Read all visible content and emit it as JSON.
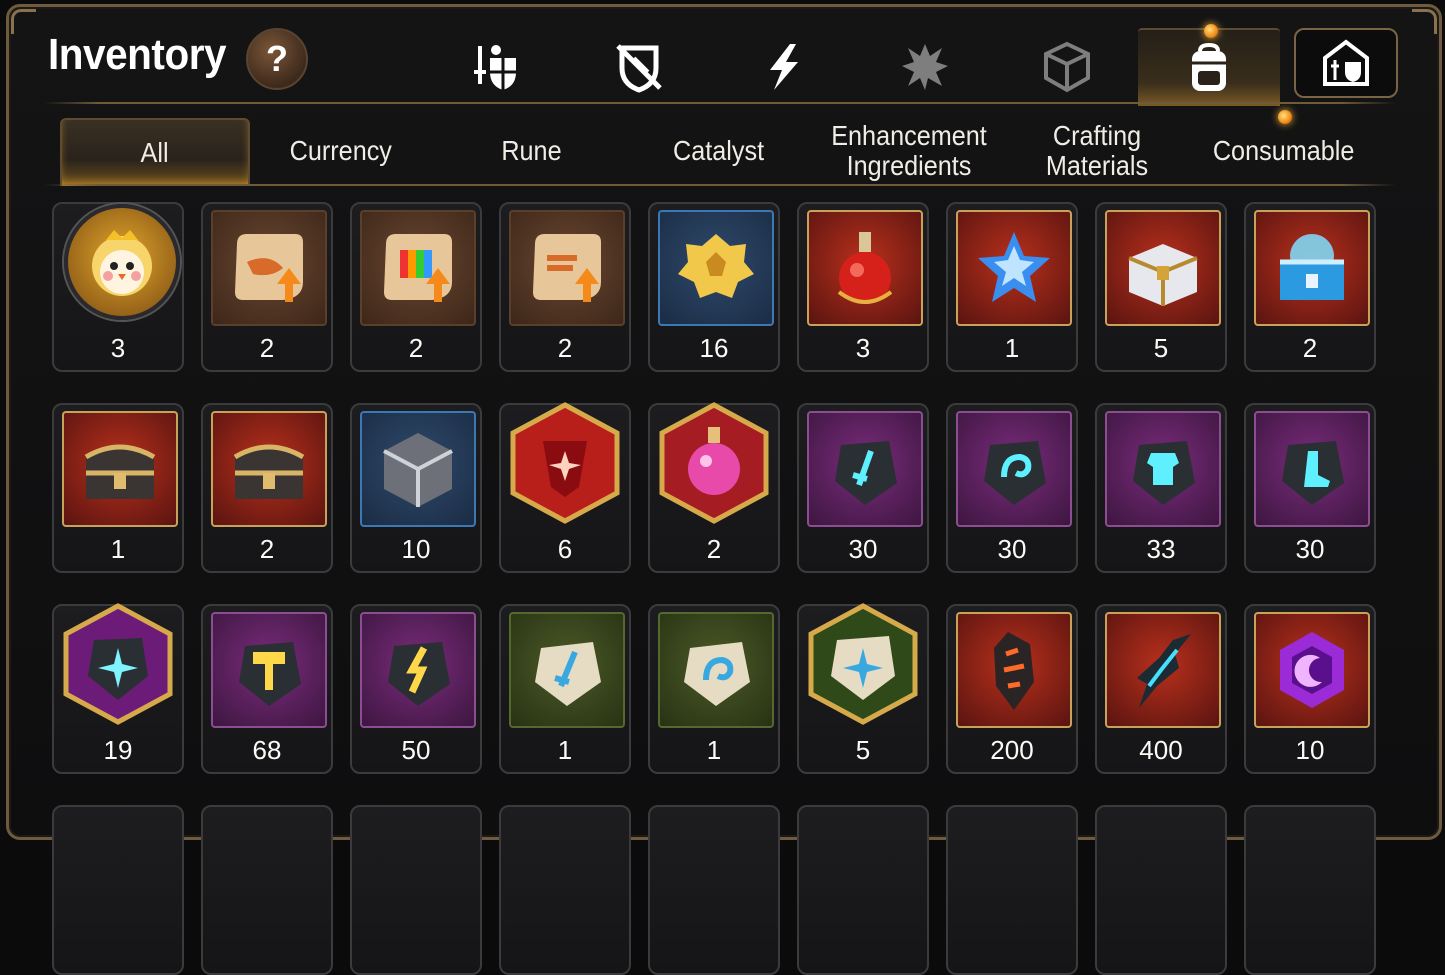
{
  "header": {
    "title": "Inventory",
    "help_label": "?"
  },
  "top_icons": [
    {
      "name": "equipment-sword-shield",
      "active": false
    },
    {
      "name": "shield-crossed",
      "active": false
    },
    {
      "name": "lightning",
      "active": false
    },
    {
      "name": "splash-emblem",
      "active": false
    },
    {
      "name": "dice-cube",
      "active": false
    },
    {
      "name": "backpack",
      "active": true,
      "notification": true
    },
    {
      "name": "sword-shield-house",
      "active": false
    }
  ],
  "tabs": [
    {
      "label": "All",
      "active": true
    },
    {
      "label": "Currency",
      "active": false
    },
    {
      "label": "Rune",
      "active": false
    },
    {
      "label": "Catalyst",
      "active": false
    },
    {
      "label": "Enhancement Ingredients",
      "active": false
    },
    {
      "label": "Crafting Materials",
      "active": false
    },
    {
      "label": "Consumable",
      "active": false,
      "notification": true
    }
  ],
  "items": [
    {
      "icon": "chick-medal-icon",
      "count": "3"
    },
    {
      "icon": "scroll-upgrade-icon",
      "count": "2"
    },
    {
      "icon": "rainbow-scroll-upgrade-icon",
      "count": "2"
    },
    {
      "icon": "scroll-upgrade-icon",
      "count": "2"
    },
    {
      "icon": "gold-nugget-icon",
      "count": "16"
    },
    {
      "icon": "red-potion-icon",
      "count": "3"
    },
    {
      "icon": "blue-star-potion-icon",
      "count": "1"
    },
    {
      "icon": "silver-gold-chest-icon",
      "count": "5"
    },
    {
      "icon": "blue-crystal-chest-icon",
      "count": "2"
    },
    {
      "icon": "dark-gold-chest-icon",
      "count": "1"
    },
    {
      "icon": "dark-gold-chest-icon",
      "count": "2"
    },
    {
      "icon": "silver-cube-icon",
      "count": "10"
    },
    {
      "icon": "red-gem-hex-icon",
      "count": "6"
    },
    {
      "icon": "pink-potion-hex-icon",
      "count": "2"
    },
    {
      "icon": "sword-stone-icon",
      "count": "30"
    },
    {
      "icon": "swirl-stone-icon",
      "count": "30"
    },
    {
      "icon": "armor-stone-icon",
      "count": "33"
    },
    {
      "icon": "boot-stone-icon",
      "count": "30"
    },
    {
      "icon": "star-stone-hex-icon",
      "count": "19"
    },
    {
      "icon": "hammer-stone-icon",
      "count": "68"
    },
    {
      "icon": "bolt-stone-icon",
      "count": "50"
    },
    {
      "icon": "sword-rune-icon",
      "count": "1"
    },
    {
      "icon": "swirl-rune-icon",
      "count": "1"
    },
    {
      "icon": "star-rune-hex-icon",
      "count": "5"
    },
    {
      "icon": "lava-crystal-icon",
      "count": "200"
    },
    {
      "icon": "dark-crystal-shard-icon",
      "count": "400"
    },
    {
      "icon": "moon-gem-icon",
      "count": "10"
    }
  ],
  "colors": {
    "gold_frame": "#6e5a3e",
    "accent_glow": "#d99a2a",
    "background": "#0b0b0c"
  }
}
